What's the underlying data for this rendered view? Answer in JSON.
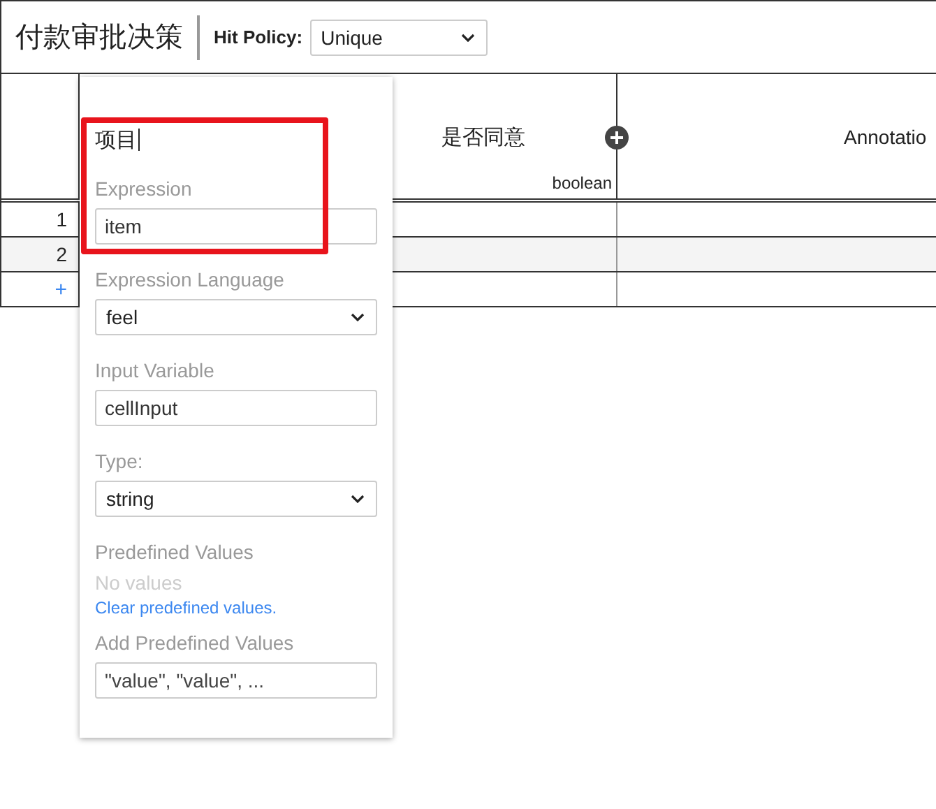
{
  "header": {
    "title": "付款审批决策",
    "hit_policy_label": "Hit Policy:",
    "hit_policy_value": "Unique"
  },
  "table": {
    "output_label": "是否同意",
    "output_type": "boolean",
    "annotation_label": "Annotatio",
    "rows": [
      {
        "number": "1"
      },
      {
        "number": "2"
      }
    ],
    "add_row": "+"
  },
  "popup": {
    "name": "项目",
    "fields": [
      {
        "kind": "input",
        "label": "Expression",
        "value": "item"
      },
      {
        "kind": "select",
        "label": "Expression Language",
        "value": "feel"
      },
      {
        "kind": "input",
        "label": "Input Variable",
        "value": "cellInput"
      },
      {
        "kind": "select",
        "label": "Type:",
        "value": "string"
      }
    ],
    "predefined_label": "Predefined Values",
    "no_values": "No values",
    "clear_link": "Clear predefined values.",
    "add_label": "Add Predefined Values",
    "add_placeholder": "\"value\", \"value\", ..."
  }
}
